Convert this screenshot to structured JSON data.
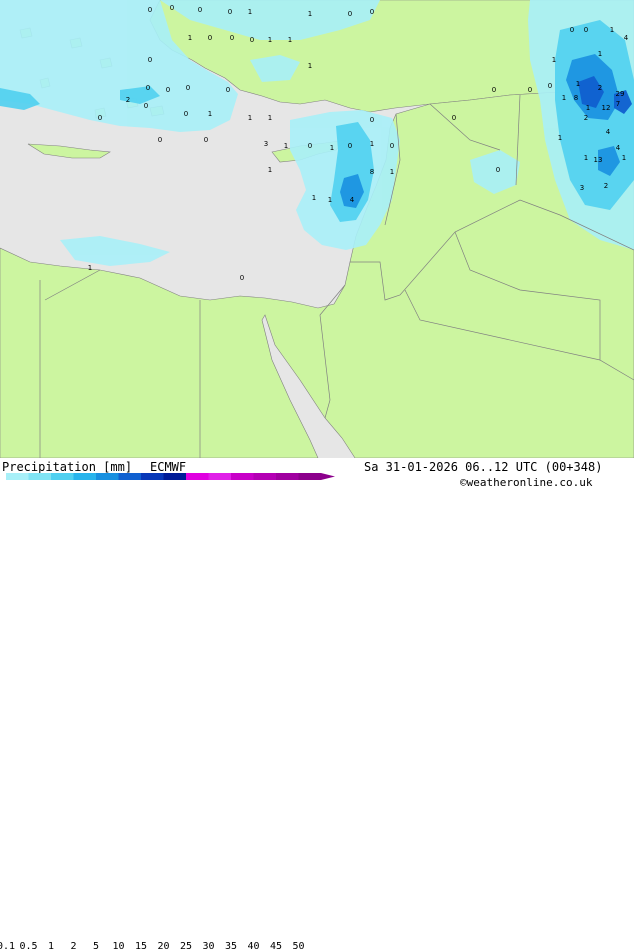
{
  "product": {
    "label": "Precipitation [mm]",
    "model": "ECMWF"
  },
  "valid_time": "Sa 31-01-2026 06..12 UTC (00+348)",
  "credit": "©weatheronline.co.uk",
  "legend": {
    "ticks": [
      "0.1",
      "0.5",
      "1",
      "2",
      "5",
      "10",
      "15",
      "20",
      "25",
      "30",
      "35",
      "40",
      "45",
      "50"
    ],
    "colors": [
      "#a8f0f8",
      "#80e4f4",
      "#50d0f0",
      "#28b4ec",
      "#1890e0",
      "#1060d0",
      "#0838b8",
      "#001c98",
      "#e000e0",
      "#e020e8",
      "#c800c8",
      "#b400b4",
      "#a000a0",
      "#8c008c"
    ]
  },
  "map_colors": {
    "sea": "#e6e6e6",
    "land": "#ccf5a0",
    "border": "#808080"
  },
  "grid_values": [
    "0",
    "0",
    "1",
    "1",
    "0",
    "0",
    "0",
    "0",
    "1",
    "0",
    "1",
    "0",
    "0",
    "0",
    "1",
    "1",
    "0",
    "0",
    "0",
    "0",
    "0",
    "0",
    "2",
    "1",
    "1",
    "1",
    "0",
    "3",
    "1",
    "0",
    "1",
    "0",
    "1",
    "0",
    "0",
    "0",
    "0",
    "1",
    "0",
    "8",
    "1",
    "1",
    "4",
    "1",
    "1",
    "0",
    "0",
    "0",
    "0",
    "0",
    "0",
    "0",
    "1",
    "1",
    "1",
    "4",
    "1",
    "1",
    "8",
    "1",
    "12",
    "7",
    "2",
    "29",
    "1",
    "2",
    "4",
    "4",
    "1",
    "13",
    "1",
    "3",
    "2"
  ]
}
